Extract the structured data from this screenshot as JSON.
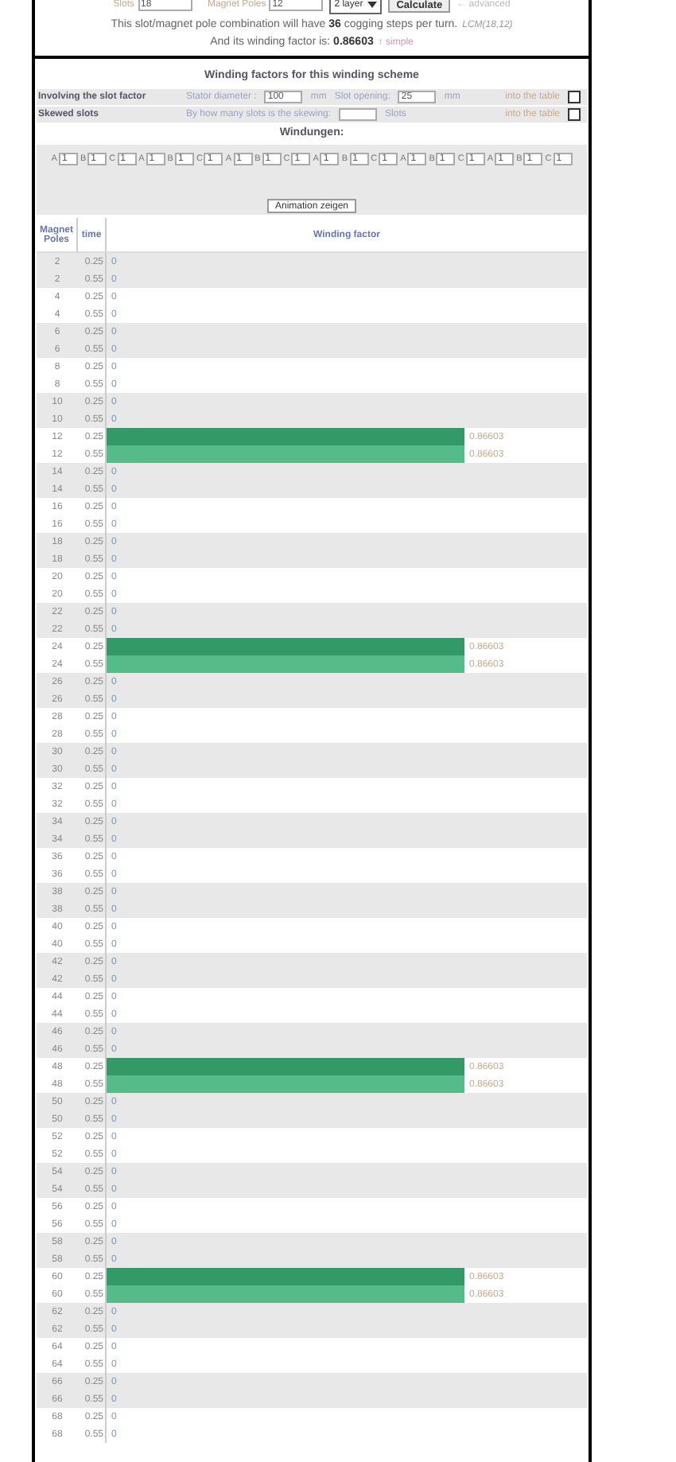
{
  "top_bar": {
    "slots_label": "Slots",
    "slots_value": "18",
    "poles_label": "Magnet Poles",
    "poles_value": "12",
    "layer_select": "2 layer",
    "calculate_button": "Calculate",
    "advanced_link": "← advanced"
  },
  "summary": {
    "cogging_text": "This slot/magnet pole combination will have **36** cogging steps per turn.",
    "lcm": "LCM(18,12)",
    "factor_text": "And its winding factor is: **0.86603**",
    "simple_link": "↑ simple"
  },
  "scheme": {
    "title": "Winding factors for this winding scheme",
    "options": [
      {
        "label": "Involving the slot factor",
        "items": [
          {
            "kind": "text",
            "text": "Stator diameter :"
          },
          {
            "kind": "field",
            "value": "100"
          },
          {
            "kind": "unit",
            "text": "mm"
          },
          {
            "kind": "text",
            "text": "Slot opening:"
          },
          {
            "kind": "field",
            "value": "25"
          },
          {
            "kind": "unit",
            "text": "mm"
          }
        ],
        "table_label": "into the table",
        "checked": false
      },
      {
        "label": "Skewed slots",
        "items": [
          {
            "kind": "text",
            "text": "By how many slots is the skewing:"
          },
          {
            "kind": "field"
          },
          {
            "kind": "unit",
            "text": "Slots"
          }
        ],
        "table_label": "into the table",
        "checked": false
      }
    ],
    "windings_title": "Windungen:",
    "windings": [
      {
        "label": "A",
        "value": "1"
      },
      {
        "label": "B",
        "value": "1"
      },
      {
        "label": "C",
        "value": "1"
      },
      {
        "label": "A",
        "value": "1"
      },
      {
        "label": "B",
        "value": "1"
      },
      {
        "label": "C",
        "value": "1"
      },
      {
        "label": "A",
        "value": "1"
      },
      {
        "label": "B",
        "value": "1"
      },
      {
        "label": "C",
        "value": "1"
      },
      {
        "label": "A",
        "value": "1"
      },
      {
        "label": "B",
        "value": "1"
      },
      {
        "label": "C",
        "value": "1"
      },
      {
        "label": "A",
        "value": "1"
      },
      {
        "label": "B",
        "value": "1"
      },
      {
        "label": "C",
        "value": "1"
      },
      {
        "label": "A",
        "value": "1"
      },
      {
        "label": "B",
        "value": "1"
      },
      {
        "label": "C",
        "value": "1"
      }
    ],
    "animation_button": "Animation zeigen"
  },
  "table": {
    "columns": [
      "Magnet Poles",
      "time",
      "Winding factor"
    ],
    "rows": [
      {
        "poles": "2",
        "time": "0.25",
        "value": "0",
        "highlighted": false
      },
      {
        "poles": "2",
        "time": "0.55",
        "value": "0",
        "highlighted": false
      },
      {
        "poles": "4",
        "time": "0.25",
        "value": "0",
        "highlighted": false
      },
      {
        "poles": "4",
        "time": "0.55",
        "value": "0",
        "highlighted": false
      },
      {
        "poles": "6",
        "time": "0.25",
        "value": "0",
        "highlighted": false
      },
      {
        "poles": "6",
        "time": "0.55",
        "value": "0",
        "highlighted": false
      },
      {
        "poles": "8",
        "time": "0.25",
        "value": "0",
        "highlighted": false
      },
      {
        "poles": "8",
        "time": "0.55",
        "value": "0",
        "highlighted": false
      },
      {
        "poles": "10",
        "time": "0.25",
        "value": "0",
        "highlighted": false
      },
      {
        "poles": "10",
        "time": "0.55",
        "value": "0",
        "highlighted": false
      },
      {
        "poles": "12",
        "time": "0.25",
        "value": "0.86603",
        "highlighted": true
      },
      {
        "poles": "12",
        "time": "0.55",
        "value": "0.86603",
        "highlighted": true
      },
      {
        "poles": "14",
        "time": "0.25",
        "value": "0",
        "highlighted": false
      },
      {
        "poles": "14",
        "time": "0.55",
        "value": "0",
        "highlighted": false
      },
      {
        "poles": "16",
        "time": "0.25",
        "value": "0",
        "highlighted": false
      },
      {
        "poles": "16",
        "time": "0.55",
        "value": "0",
        "highlighted": false
      },
      {
        "poles": "18",
        "time": "0.25",
        "value": "0",
        "highlighted": false
      },
      {
        "poles": "18",
        "time": "0.55",
        "value": "0",
        "highlighted": false
      },
      {
        "poles": "20",
        "time": "0.25",
        "value": "0",
        "highlighted": false
      },
      {
        "poles": "20",
        "time": "0.55",
        "value": "0",
        "highlighted": false
      },
      {
        "poles": "22",
        "time": "0.25",
        "value": "0",
        "highlighted": false
      },
      {
        "poles": "22",
        "time": "0.55",
        "value": "0",
        "highlighted": false
      },
      {
        "poles": "24",
        "time": "0.25",
        "value": "0.86603",
        "highlighted": true
      },
      {
        "poles": "24",
        "time": "0.55",
        "value": "0.86603",
        "highlighted": true
      },
      {
        "poles": "26",
        "time": "0.25",
        "value": "0",
        "highlighted": false
      },
      {
        "poles": "26",
        "time": "0.55",
        "value": "0",
        "highlighted": false
      },
      {
        "poles": "28",
        "time": "0.25",
        "value": "0",
        "highlighted": false
      },
      {
        "poles": "28",
        "time": "0.55",
        "value": "0",
        "highlighted": false
      },
      {
        "poles": "30",
        "time": "0.25",
        "value": "0",
        "highlighted": false
      },
      {
        "poles": "30",
        "time": "0.55",
        "value": "0",
        "highlighted": false
      },
      {
        "poles": "32",
        "time": "0.25",
        "value": "0",
        "highlighted": false
      },
      {
        "poles": "32",
        "time": "0.55",
        "value": "0",
        "highlighted": false
      },
      {
        "poles": "34",
        "time": "0.25",
        "value": "0",
        "highlighted": false
      },
      {
        "poles": "34",
        "time": "0.55",
        "value": "0",
        "highlighted": false
      },
      {
        "poles": "36",
        "time": "0.25",
        "value": "0",
        "highlighted": false
      },
      {
        "poles": "36",
        "time": "0.55",
        "value": "0",
        "highlighted": false
      },
      {
        "poles": "38",
        "time": "0.25",
        "value": "0",
        "highlighted": false
      },
      {
        "poles": "38",
        "time": "0.55",
        "value": "0",
        "highlighted": false
      },
      {
        "poles": "40",
        "time": "0.25",
        "value": "0",
        "highlighted": false
      },
      {
        "poles": "40",
        "time": "0.55",
        "value": "0",
        "highlighted": false
      },
      {
        "poles": "42",
        "time": "0.25",
        "value": "0",
        "highlighted": false
      },
      {
        "poles": "42",
        "time": "0.55",
        "value": "0",
        "highlighted": false
      },
      {
        "poles": "44",
        "time": "0.25",
        "value": "0",
        "highlighted": false
      },
      {
        "poles": "44",
        "time": "0.55",
        "value": "0",
        "highlighted": false
      },
      {
        "poles": "46",
        "time": "0.25",
        "value": "0",
        "highlighted": false
      },
      {
        "poles": "46",
        "time": "0.55",
        "value": "0",
        "highlighted": false
      },
      {
        "poles": "48",
        "time": "0.25",
        "value": "0.86603",
        "highlighted": true
      },
      {
        "poles": "48",
        "time": "0.55",
        "value": "0.86603",
        "highlighted": true
      },
      {
        "poles": "50",
        "time": "0.25",
        "value": "0",
        "highlighted": false
      },
      {
        "poles": "50",
        "time": "0.55",
        "value": "0",
        "highlighted": false
      },
      {
        "poles": "52",
        "time": "0.25",
        "value": "0",
        "highlighted": false
      },
      {
        "poles": "52",
        "time": "0.55",
        "value": "0",
        "highlighted": false
      },
      {
        "poles": "54",
        "time": "0.25",
        "value": "0",
        "highlighted": false
      },
      {
        "poles": "54",
        "time": "0.55",
        "value": "0",
        "highlighted": false
      },
      {
        "poles": "56",
        "time": "0.25",
        "value": "0",
        "highlighted": false
      },
      {
        "poles": "56",
        "time": "0.55",
        "value": "0",
        "highlighted": false
      },
      {
        "poles": "58",
        "time": "0.25",
        "value": "0",
        "highlighted": false
      },
      {
        "poles": "58",
        "time": "0.55",
        "value": "0",
        "highlighted": false
      },
      {
        "poles": "60",
        "time": "0.25",
        "value": "0.86603",
        "highlighted": true
      },
      {
        "poles": "60",
        "time": "0.55",
        "value": "0.86603",
        "highlighted": true
      },
      {
        "poles": "62",
        "time": "0.25",
        "value": "0",
        "highlighted": false
      },
      {
        "poles": "62",
        "time": "0.55",
        "value": "0",
        "highlighted": false
      },
      {
        "poles": "64",
        "time": "0.25",
        "value": "0",
        "highlighted": false
      },
      {
        "poles": "64",
        "time": "0.55",
        "value": "0",
        "highlighted": false
      },
      {
        "poles": "66",
        "time": "0.25",
        "value": "0",
        "highlighted": false
      },
      {
        "poles": "66",
        "time": "0.55",
        "value": "0",
        "highlighted": false
      },
      {
        "poles": "68",
        "time": "0.25",
        "value": "0",
        "highlighted": false
      },
      {
        "poles": "68",
        "time": "0.55",
        "value": "0",
        "highlighted": false
      }
    ]
  }
}
